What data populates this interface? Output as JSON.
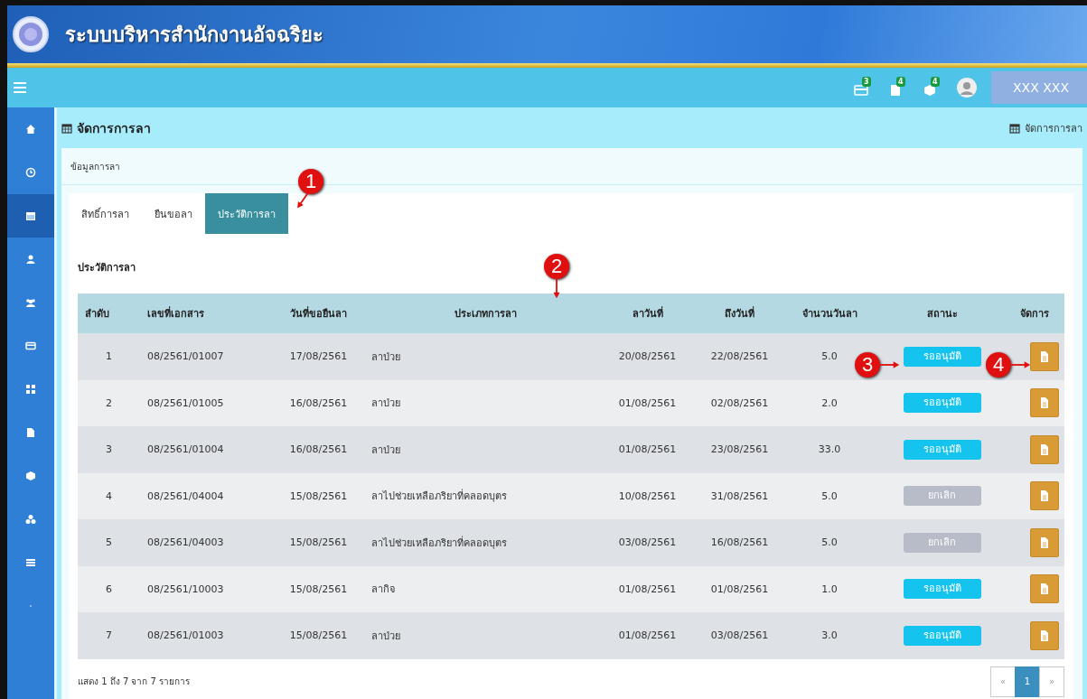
{
  "header": {
    "title": "ระบบบริหารสำนักงานอัจฉริยะ"
  },
  "topbar": {
    "notifications": [
      {
        "count": "3"
      },
      {
        "count": "4"
      },
      {
        "count": "4"
      }
    ],
    "user": "XXX XXX"
  },
  "sidebar": {
    "items": [
      {
        "selected": false
      },
      {
        "selected": false
      },
      {
        "selected": true
      },
      {
        "selected": false
      },
      {
        "selected": false
      },
      {
        "selected": false
      },
      {
        "selected": false
      },
      {
        "selected": false
      },
      {
        "selected": false
      },
      {
        "selected": false
      },
      {
        "selected": false
      },
      {
        "selected": false
      }
    ]
  },
  "page": {
    "title": "จัดการการลา",
    "breadcrumb": "จัดการการลา"
  },
  "panel": {
    "heading": "ข้อมูลการลา",
    "tabs": [
      {
        "label": "สิทธิ์การลา",
        "selected": false
      },
      {
        "label": "ยืนขอลา",
        "selected": false
      },
      {
        "label": "ประวัติการลา",
        "selected": true
      }
    ],
    "section_title": "ประวัติการลา",
    "table": {
      "columns": [
        "ลำดับ",
        "เลขที่เอกสาร",
        "วันที่ขอยืนลา",
        "ประเภทการลา",
        "ลาวันที่",
        "ถึงวันที่",
        "จำนวนวันลา",
        "สถานะ",
        "จัดการ"
      ],
      "rows": [
        {
          "no": "1",
          "doc": "08/2561/01007",
          "requested": "17/08/2561",
          "type": "ลาป่วย",
          "from": "20/08/2561",
          "to": "22/08/2561",
          "days": "5.0",
          "status": {
            "label": "รออนุมัติ",
            "kind": "pending"
          }
        },
        {
          "no": "2",
          "doc": "08/2561/01005",
          "requested": "16/08/2561",
          "type": "ลาป่วย",
          "from": "01/08/2561",
          "to": "02/08/2561",
          "days": "2.0",
          "status": {
            "label": "รออนุมัติ",
            "kind": "pending"
          }
        },
        {
          "no": "3",
          "doc": "08/2561/01004",
          "requested": "16/08/2561",
          "type": "ลาป่วย",
          "from": "01/08/2561",
          "to": "23/08/2561",
          "days": "33.0",
          "status": {
            "label": "รออนุมัติ",
            "kind": "pending"
          }
        },
        {
          "no": "4",
          "doc": "08/2561/04004",
          "requested": "15/08/2561",
          "type": "ลาไปช่วยเหลือภริยาที่คลอดบุตร",
          "from": "10/08/2561",
          "to": "31/08/2561",
          "days": "5.0",
          "status": {
            "label": "ยกเลิก",
            "kind": "cancelled"
          }
        },
        {
          "no": "5",
          "doc": "08/2561/04003",
          "requested": "15/08/2561",
          "type": "ลาไปช่วยเหลือภริยาที่คลอดบุตร",
          "from": "03/08/2561",
          "to": "16/08/2561",
          "days": "5.0",
          "status": {
            "label": "ยกเลิก",
            "kind": "cancelled"
          }
        },
        {
          "no": "6",
          "doc": "08/2561/10003",
          "requested": "15/08/2561",
          "type": "ลากิจ",
          "from": "01/08/2561",
          "to": "01/08/2561",
          "days": "1.0",
          "status": {
            "label": "รออนุมัติ",
            "kind": "pending"
          }
        },
        {
          "no": "7",
          "doc": "08/2561/01003",
          "requested": "15/08/2561",
          "type": "ลาป่วย",
          "from": "01/08/2561",
          "to": "03/08/2561",
          "days": "3.0",
          "status": {
            "label": "รออนุมัติ",
            "kind": "pending"
          }
        }
      ]
    },
    "footer": "แสดง 1 ถึง 7 จาก 7 รายการ",
    "pagination": [
      {
        "label": "«",
        "selected": false
      },
      {
        "label": "1",
        "selected": true
      },
      {
        "label": "»",
        "selected": false
      }
    ]
  },
  "callouts": [
    {
      "number": "1"
    },
    {
      "number": "2"
    },
    {
      "number": "3"
    },
    {
      "number": "4"
    }
  ]
}
